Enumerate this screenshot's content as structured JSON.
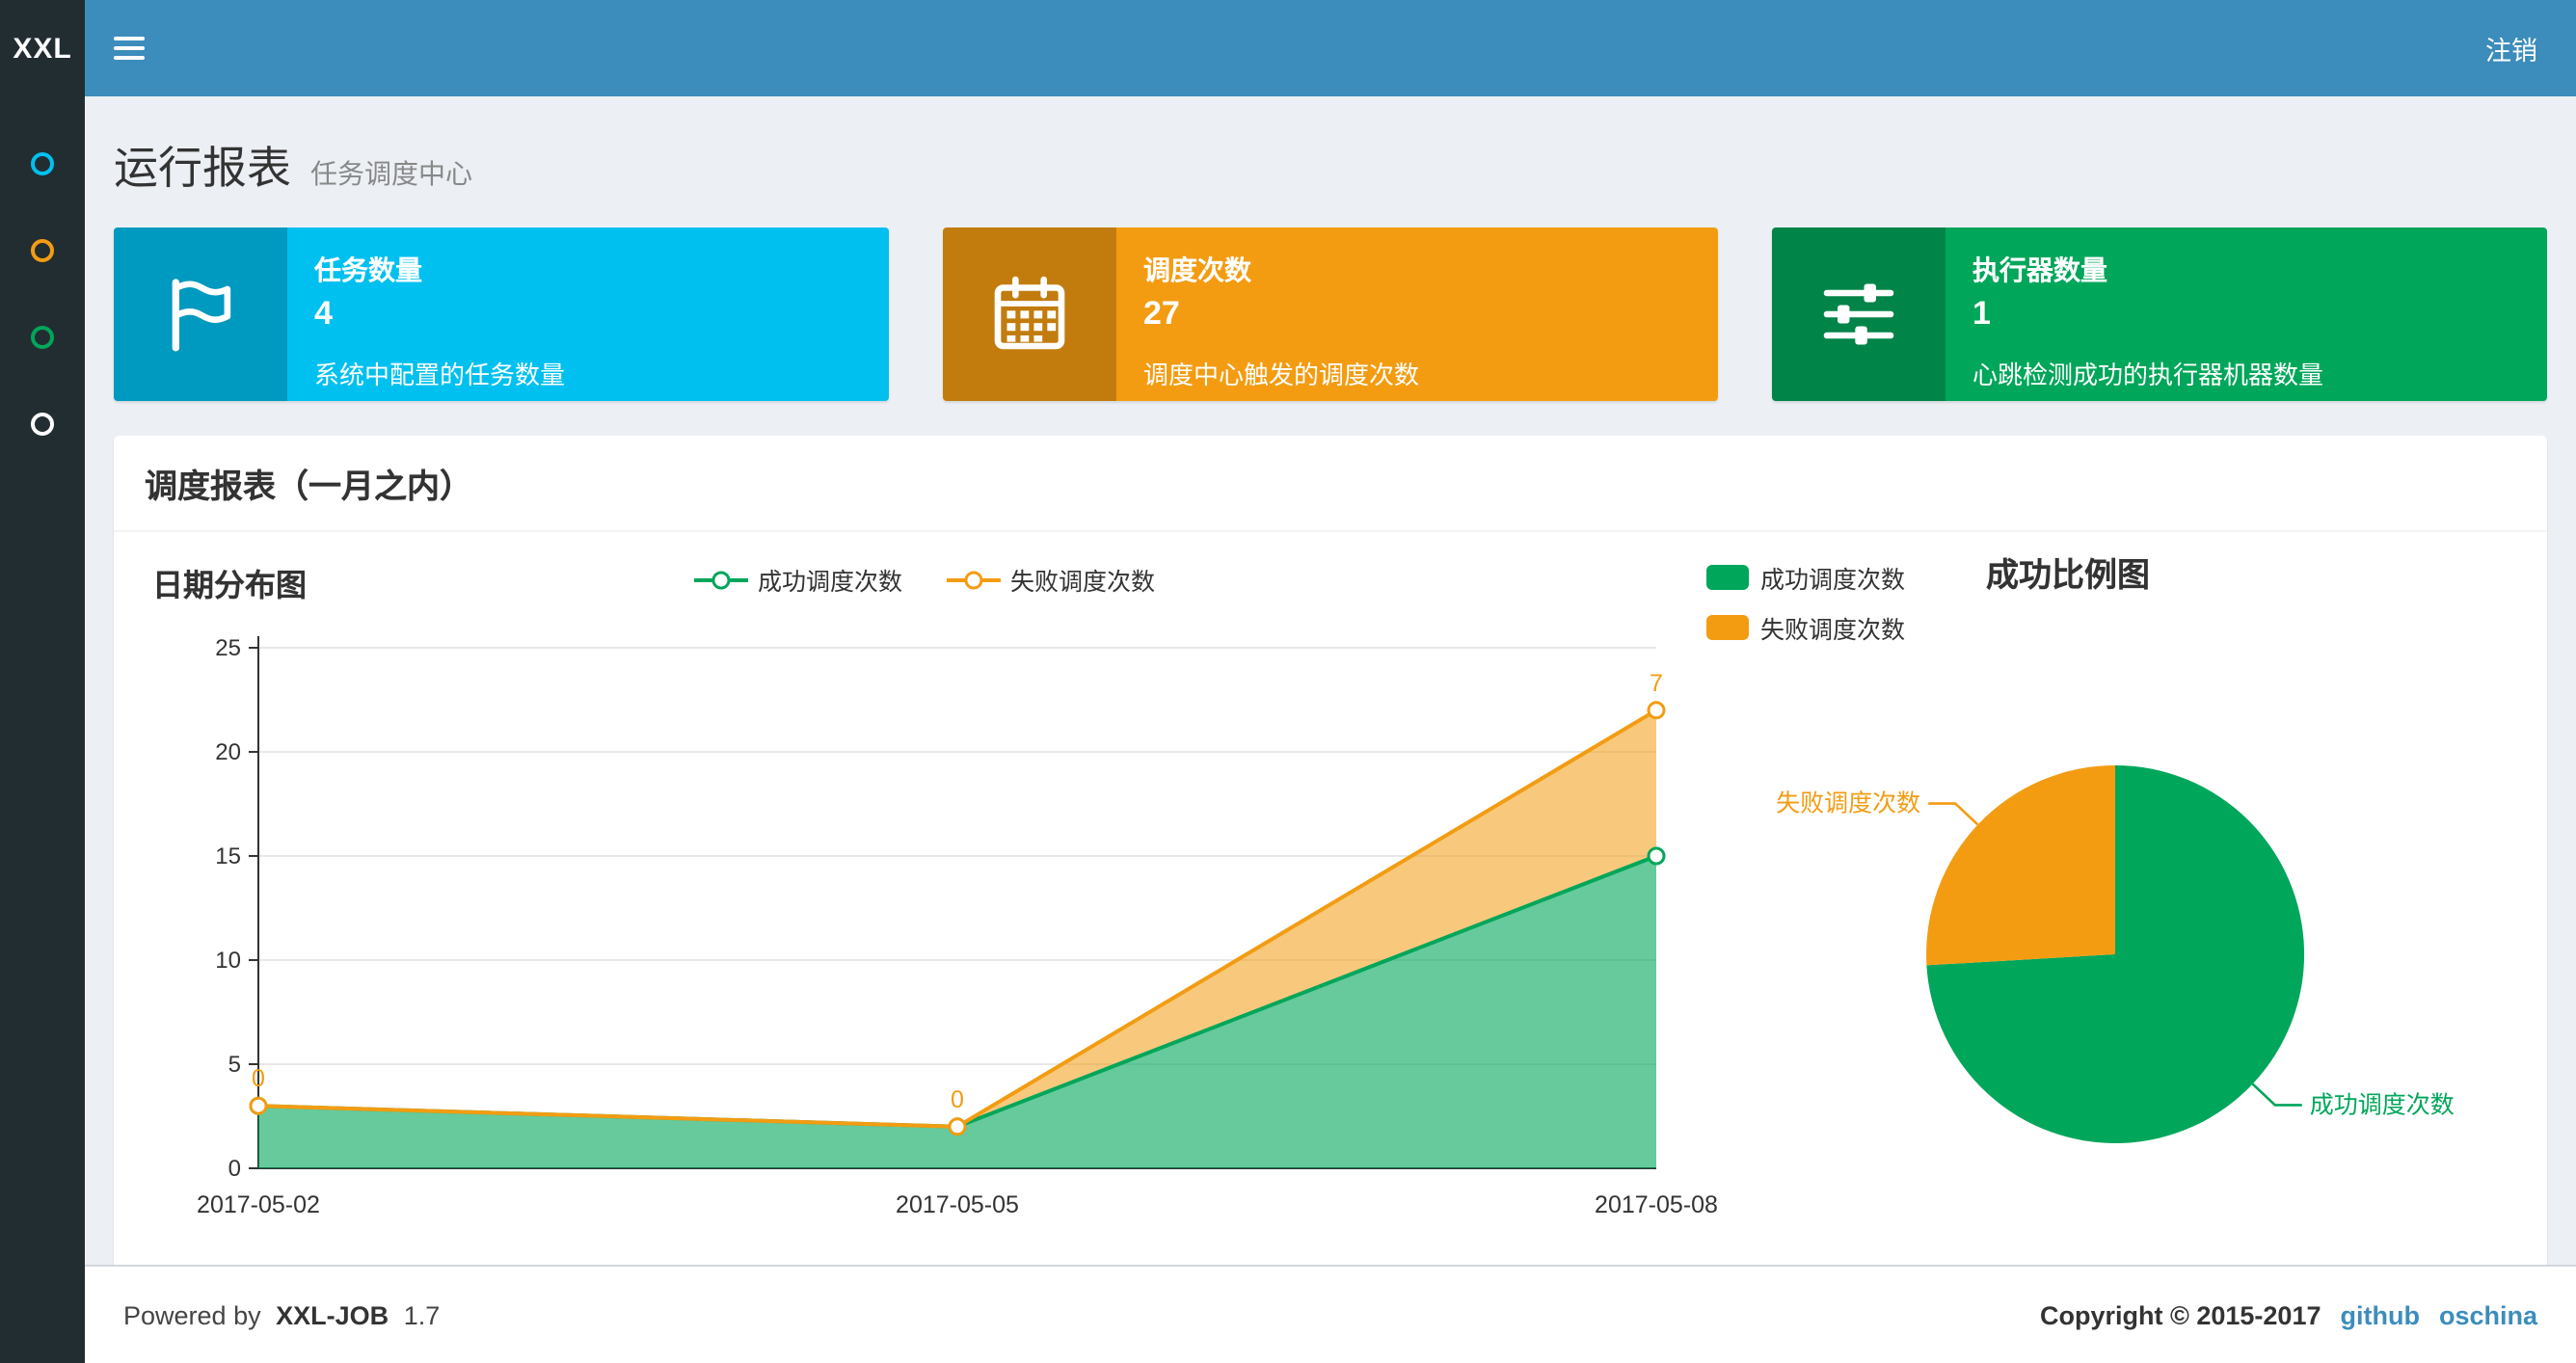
{
  "header": {
    "logo": "XXL",
    "logout_label": "注销"
  },
  "sidebar": {
    "items": [
      {
        "icon": "circle-blue",
        "color": "#00c0ef"
      },
      {
        "icon": "circle-orange",
        "color": "#f39c12"
      },
      {
        "icon": "circle-green",
        "color": "#00a65a"
      },
      {
        "icon": "circle-white",
        "color": "#ffffff"
      }
    ]
  },
  "page": {
    "title": "运行报表",
    "subtitle": "任务调度中心"
  },
  "info_boxes": [
    {
      "icon": "flag-icon",
      "title": "任务数量",
      "value": "4",
      "desc": "系统中配置的任务数量",
      "color": "#00c0ef"
    },
    {
      "icon": "calendar-icon",
      "title": "调度次数",
      "value": "27",
      "desc": "调度中心触发的调度次数",
      "color": "#f39c12"
    },
    {
      "icon": "sliders-icon",
      "title": "执行器数量",
      "value": "1",
      "desc": "心跳检测成功的执行器机器数量",
      "color": "#00a65a"
    }
  ],
  "panel": {
    "title": "调度报表（一月之内）"
  },
  "chart_data": [
    {
      "type": "area",
      "title": "日期分布图",
      "x": [
        "2017-05-02",
        "2017-05-05",
        "2017-05-08"
      ],
      "series": [
        {
          "name": "成功调度次数",
          "color": "#00a65a",
          "fill": "rgba(0,166,90,0.6)",
          "values": [
            3,
            2,
            15
          ],
          "show_labels": false
        },
        {
          "name": "失败调度次数",
          "color": "#f39c12",
          "fill": "rgba(243,156,18,0.55)",
          "values": [
            0,
            0,
            7
          ],
          "show_labels": true
        }
      ],
      "stacked": true,
      "ylim": [
        0,
        25
      ],
      "yticks": [
        0,
        5,
        10,
        15,
        20,
        25
      ],
      "grid": true,
      "legend_position": "top-center"
    },
    {
      "type": "pie",
      "title": "成功比例图",
      "slices": [
        {
          "name": "成功调度次数",
          "value": 20,
          "color": "#00a65a"
        },
        {
          "name": "失败调度次数",
          "value": 7,
          "color": "#f39c12"
        }
      ],
      "legend_position": "top-left"
    }
  ],
  "footer": {
    "powered_by": "Powered by",
    "brand": "XXL-JOB",
    "version": "1.7",
    "copyright": "Copyright © 2015-2017",
    "links": [
      {
        "label": "github"
      },
      {
        "label": "oschina"
      }
    ]
  }
}
